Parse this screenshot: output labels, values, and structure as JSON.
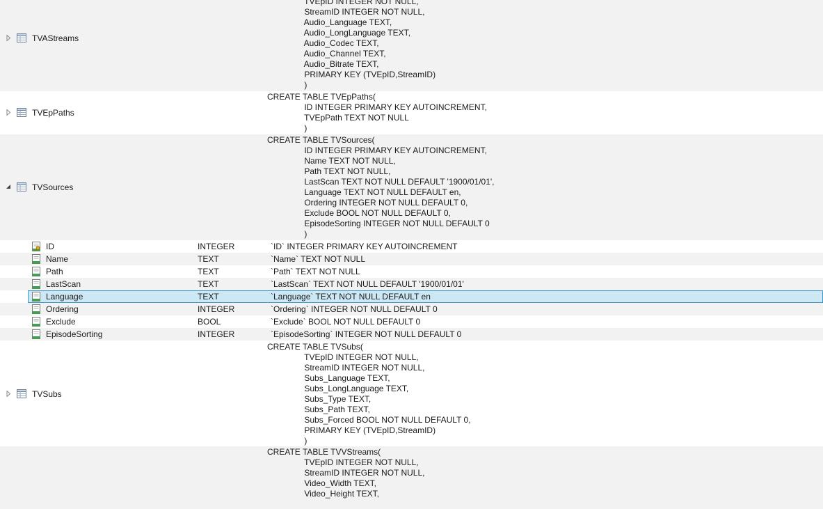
{
  "tables": [
    {
      "name": "TVAStreams",
      "expanded": false,
      "sql_lines": [
        "                TVEpID INTEGER NOT NULL,",
        "                StreamID INTEGER NOT NULL,",
        "                Audio_Language TEXT,",
        "                Audio_LongLanguage TEXT,",
        "                Audio_Codec TEXT,",
        "                Audio_Channel TEXT,",
        "                Audio_Bitrate TEXT,",
        "                PRIMARY KEY (TVEpID,StreamID)",
        "                )"
      ]
    },
    {
      "name": "TVEpPaths",
      "expanded": false,
      "sql_lines": [
        "CREATE TABLE TVEpPaths(",
        "                ID INTEGER PRIMARY KEY AUTOINCREMENT,",
        "                TVEpPath TEXT NOT NULL",
        "                )"
      ]
    },
    {
      "name": "TVSources",
      "expanded": true,
      "sql_lines": [
        "CREATE TABLE TVSources(",
        "                ID INTEGER PRIMARY KEY AUTOINCREMENT,",
        "                Name TEXT NOT NULL,",
        "                Path TEXT NOT NULL,",
        "                LastScan TEXT NOT NULL DEFAULT '1900/01/01',",
        "                Language TEXT NOT NULL DEFAULT en,",
        "                Ordering INTEGER NOT NULL DEFAULT 0,",
        "                Exclude BOOL NOT NULL DEFAULT 0,",
        "                EpisodeSorting INTEGER NOT NULL DEFAULT 0",
        "                )"
      ],
      "columns": [
        {
          "name": "ID",
          "type": "INTEGER",
          "schema": "`ID` INTEGER PRIMARY KEY AUTOINCREMENT",
          "key": true
        },
        {
          "name": "Name",
          "type": "TEXT",
          "schema": "`Name` TEXT NOT NULL"
        },
        {
          "name": "Path",
          "type": "TEXT",
          "schema": "`Path` TEXT NOT NULL"
        },
        {
          "name": "LastScan",
          "type": "TEXT",
          "schema": "`LastScan` TEXT NOT NULL DEFAULT '1900/01/01'"
        },
        {
          "name": "Language",
          "type": "TEXT",
          "schema": "`Language` TEXT NOT NULL DEFAULT en",
          "selected": true
        },
        {
          "name": "Ordering",
          "type": "INTEGER",
          "schema": "`Ordering` INTEGER NOT NULL DEFAULT 0"
        },
        {
          "name": "Exclude",
          "type": "BOOL",
          "schema": "`Exclude` BOOL NOT NULL DEFAULT 0"
        },
        {
          "name": "EpisodeSorting",
          "type": "INTEGER",
          "schema": "`EpisodeSorting` INTEGER NOT NULL DEFAULT 0"
        }
      ]
    },
    {
      "name": "TVSubs",
      "expanded": false,
      "sql_lines": [
        "CREATE TABLE TVSubs(",
        "                TVEpID INTEGER NOT NULL,",
        "                StreamID INTEGER NOT NULL,",
        "                Subs_Language TEXT,",
        "                Subs_LongLanguage TEXT,",
        "                Subs_Type TEXT,",
        "                Subs_Path TEXT,",
        "                Subs_Forced BOOL NOT NULL DEFAULT 0,",
        "                PRIMARY KEY (TVEpID,StreamID)",
        "                )"
      ]
    },
    {
      "name": "",
      "expanded": false,
      "sql_lines": [
        "CREATE TABLE TVVStreams(",
        "                TVEpID INTEGER NOT NULL,",
        "                StreamID INTEGER NOT NULL,",
        "                Video_Width TEXT,",
        "                Video_Height TEXT,"
      ]
    }
  ],
  "colors": {
    "row_shade": "#f2f2f2",
    "selection_fill": "#cce8f5",
    "selection_border": "#3d99cc"
  },
  "icons": {
    "table": "table-icon",
    "column": "column-icon",
    "key_column": "key-column-icon",
    "collapsed": "expand-triangle-icon",
    "expanded": "collapse-triangle-icon"
  }
}
